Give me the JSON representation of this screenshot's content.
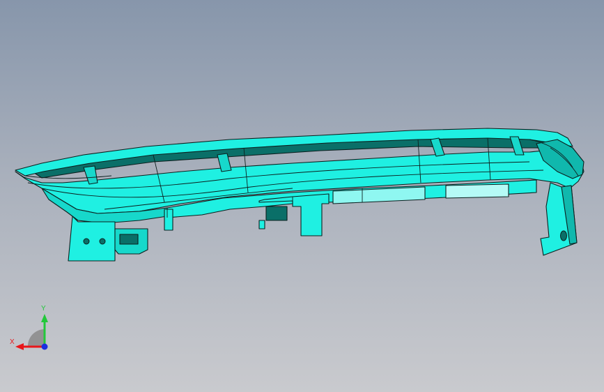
{
  "viewport": {
    "background_top": "#8796ab",
    "background_bottom": "#c9cace"
  },
  "model": {
    "name": "",
    "face_color": "#1ff0e2",
    "face_shade_color": "#10b8ad",
    "inner_face_color": "#0a6f68",
    "edge_color": "#0c1f1e"
  },
  "triad": {
    "x_label": "X",
    "y_label": "Y",
    "x_color": "#e8161a",
    "y_color": "#22c83a",
    "z_color": "#1b2fe0",
    "origin_disc_color": "#8a8a8a"
  }
}
